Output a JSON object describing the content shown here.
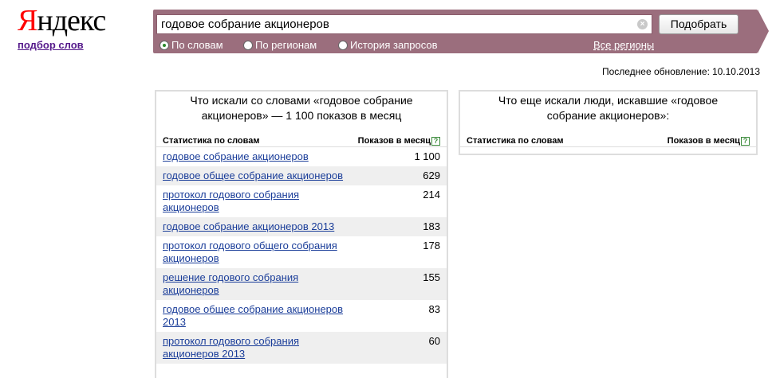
{
  "logo": {
    "text_first": "Я",
    "text_rest": "ндекс",
    "subtitle": "подбор слов"
  },
  "search": {
    "query": "годовое собрание акционеров",
    "submit_label": "Подобрать",
    "clear_symbol": "×",
    "modes": [
      {
        "label": "По словам",
        "selected": true
      },
      {
        "label": "По регионам",
        "selected": false
      },
      {
        "label": "История запросов",
        "selected": false
      }
    ],
    "regions_label": "Все регионы"
  },
  "last_update": {
    "label": "Последнее обновление:",
    "date": "10.10.2013"
  },
  "left_panel": {
    "title": "Что искали со словами «годовое собрание акционеров» — 1 100 показов в месяц",
    "col_phrase": "Статистика по словам",
    "col_count": "Показов в месяц",
    "help_symbol": "?",
    "rows": [
      {
        "phrase": "годовое собрание акционеров",
        "count": "1 100"
      },
      {
        "phrase": "годовое общее собрание акционеров",
        "count": "629"
      },
      {
        "phrase": "протокол годового собрания акционеров",
        "count": "214"
      },
      {
        "phrase": "годовое собрание акционеров 2013",
        "count": "183"
      },
      {
        "phrase": "протокол годового общего собрания акционеров",
        "count": "178"
      },
      {
        "phrase": "решение годового собрания акционеров",
        "count": "155"
      },
      {
        "phrase": "годовое общее собрание акционеров 2013",
        "count": "83"
      },
      {
        "phrase": "протокол годового собрания акционеров 2013",
        "count": "60"
      }
    ]
  },
  "right_panel": {
    "title": "Что еще искали люди, искавшие «годовое собрание акционеров»:",
    "col_phrase": "Статистика по словам",
    "col_count": "Показов в месяц",
    "help_symbol": "?"
  },
  "colors": {
    "bar": "#9b6e7d",
    "link": "#1a3d99",
    "logo_red": "#ff0000",
    "row_alt": "#efefef"
  }
}
